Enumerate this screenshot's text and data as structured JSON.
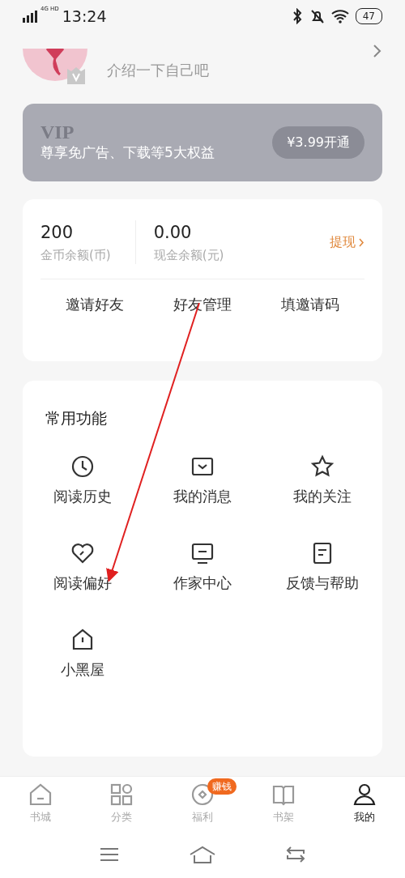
{
  "status_bar": {
    "network": "4G HD",
    "time": "13:24",
    "battery": "47"
  },
  "profile": {
    "bio": "介绍一下自己吧"
  },
  "vip": {
    "title": "VIP",
    "subtitle": "尊享免广告、下载等5大权益",
    "button": "¥3.99开通"
  },
  "wallet": {
    "balances": [
      {
        "value": "200",
        "label": "金币余额(币)"
      },
      {
        "value": "0.00",
        "label": "现金余额(元)"
      }
    ],
    "withdraw": "提现",
    "actions": [
      "邀请好友",
      "好友管理",
      "填邀请码"
    ]
  },
  "features": {
    "title": "常用功能",
    "items": [
      "阅读历史",
      "我的消息",
      "我的关注",
      "阅读偏好",
      "作家中心",
      "反馈与帮助",
      "小黑屋"
    ]
  },
  "bottom_nav": [
    {
      "label": "书城",
      "selected": false
    },
    {
      "label": "分类",
      "selected": false
    },
    {
      "label": "福利",
      "selected": false,
      "badge": "赚钱"
    },
    {
      "label": "书架",
      "selected": false
    },
    {
      "label": "我的",
      "selected": true
    }
  ]
}
